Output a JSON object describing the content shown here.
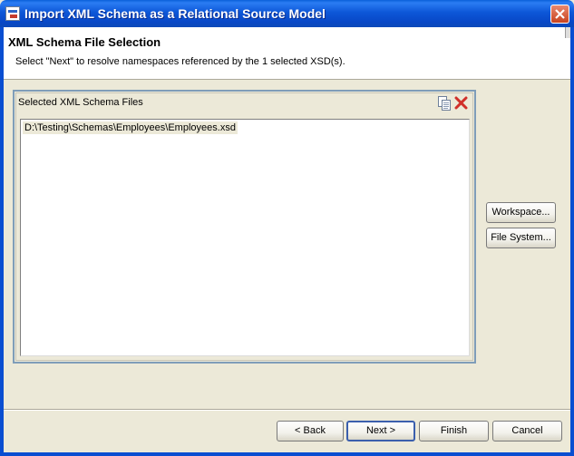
{
  "window": {
    "title": "Import XML Schema as a Relational Source Model",
    "icons": {
      "app": "app-window-icon",
      "close": "close-icon"
    }
  },
  "header": {
    "title": "XML Schema File Selection",
    "description": "Select \"Next\" to resolve namespaces referenced by the 1 selected XSD(s)."
  },
  "group": {
    "title": "Selected XML Schema Files",
    "tools": {
      "copy": "copy-icon",
      "delete": "delete-icon"
    },
    "files": [
      "D:\\Testing\\Schemas\\Employees\\Employees.xsd"
    ]
  },
  "side_buttons": {
    "workspace": "Workspace...",
    "filesystem": "File System..."
  },
  "footer": {
    "back": "< Back",
    "next": "Next >",
    "finish": "Finish",
    "cancel": "Cancel"
  },
  "colors": {
    "titlebar": "#0a58dc",
    "dialog_bg": "#ece9d8",
    "group_border": "#7f9db9",
    "close_button": "#d85a35",
    "delete_icon": "#d0302a"
  }
}
